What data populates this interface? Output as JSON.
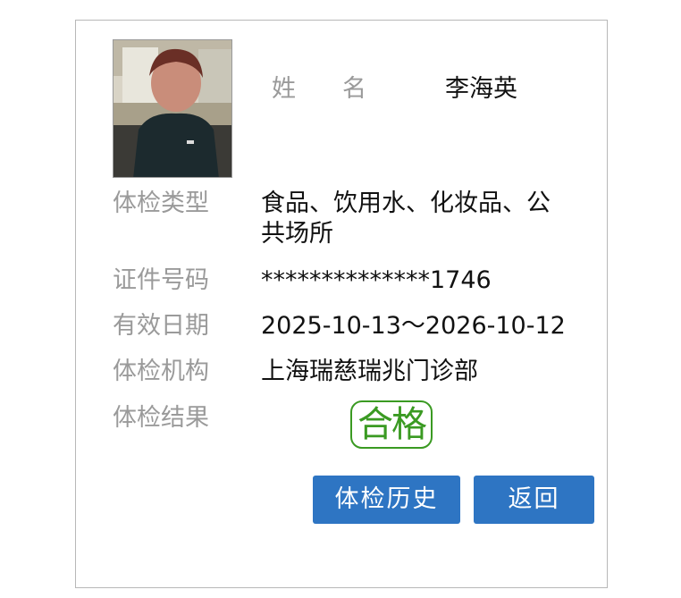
{
  "person": {
    "name_label_1": "姓",
    "name_label_2": "名",
    "name": "李海英"
  },
  "fields": [
    {
      "label": "体检类型",
      "value": "食品、饮用水、化妆品、公共场所"
    },
    {
      "label": "证件号码",
      "value": "**************1746"
    },
    {
      "label": "有效日期",
      "value": "2025-10-13～2026-10-12"
    },
    {
      "label": "体检机构",
      "value": "上海瑞慈瑞兆门诊部"
    },
    {
      "label": "体检结果",
      "value": ""
    }
  ],
  "result": {
    "text": "合格",
    "color": "#3a9a22"
  },
  "buttons": {
    "history": "体检历史",
    "back": "返回",
    "color": "#2e75c3"
  }
}
